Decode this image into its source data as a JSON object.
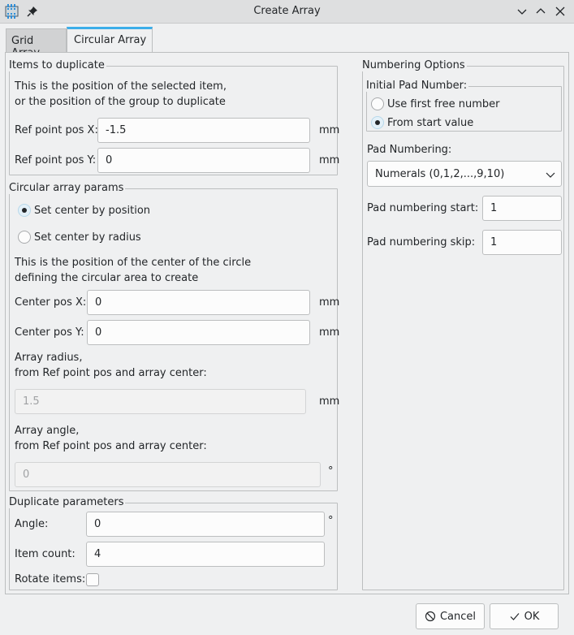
{
  "window": {
    "title": "Create Array",
    "icons": [
      "app-icon",
      "pin-icon",
      "minimize-icon",
      "maximize-icon",
      "close-icon"
    ]
  },
  "tabs": [
    {
      "label": "Grid Array",
      "active": false
    },
    {
      "label": "Circular Array",
      "active": true
    }
  ],
  "items_to_duplicate": {
    "title": "Items to duplicate",
    "help_line1": "This is the position of the selected item,",
    "help_line2": "or the position of the group to duplicate",
    "ref_x_label": "Ref point pos X:",
    "ref_x_value": "-1.5",
    "ref_x_unit": "mm",
    "ref_y_label": "Ref point pos Y:",
    "ref_y_value": "0",
    "ref_y_unit": "mm"
  },
  "circular_params": {
    "title": "Circular array params",
    "radio_position": "Set center by position",
    "radio_radius": "Set center by radius",
    "selected": "position",
    "help_line1": "This is the position of the center of the circle",
    "help_line2": "defining the circular area to create",
    "center_x_label": "Center pos X:",
    "center_x_value": "0",
    "center_x_unit": "mm",
    "center_y_label": "Center pos Y:",
    "center_y_value": "0",
    "center_y_unit": "mm",
    "radius_label1": "Array radius,",
    "radius_label2": "from Ref point pos and array center:",
    "radius_value": "1.5",
    "radius_unit": "mm",
    "angle_label1": "Array angle,",
    "angle_label2": "from Ref point pos and array center:",
    "angle_value": "0",
    "angle_unit": "°"
  },
  "duplicate_params": {
    "title": "Duplicate parameters",
    "angle_label": "Angle:",
    "angle_value": "0",
    "angle_unit": "°",
    "count_label": "Item count:",
    "count_value": "4",
    "rotate_label": "Rotate items:",
    "rotate_checked": false
  },
  "numbering": {
    "title": "Numbering Options",
    "initial_title": "Initial Pad Number:",
    "radio_first_free": "Use first free number",
    "radio_start_value": "From start value",
    "selected": "start_value",
    "pad_numbering_label": "Pad Numbering:",
    "pad_numbering_value": "Numerals (0,1,2,...,9,10)",
    "start_label": "Pad numbering start:",
    "start_value": "1",
    "skip_label": "Pad numbering skip:",
    "skip_value": "1"
  },
  "buttons": {
    "cancel": "Cancel",
    "ok": "OK"
  }
}
